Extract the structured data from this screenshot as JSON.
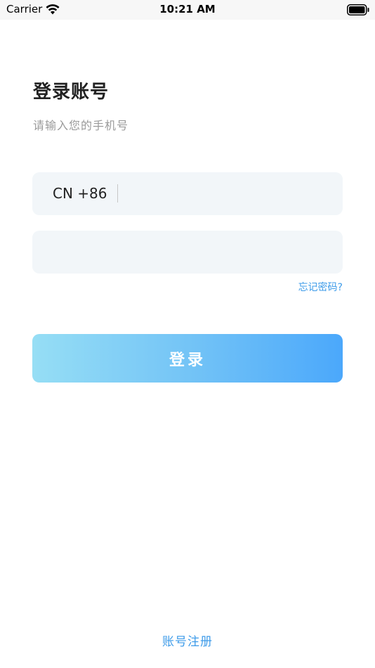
{
  "status_bar": {
    "carrier": "Carrier",
    "time": "10:21 AM"
  },
  "header": {
    "title": "登录账号",
    "subtitle": "请输入您的手机号"
  },
  "phone_field": {
    "country_code": "CN +86",
    "value": "",
    "placeholder": ""
  },
  "password_field": {
    "value": "",
    "placeholder": ""
  },
  "links": {
    "forgot_password": "忘记密码?",
    "register": "账号注册"
  },
  "buttons": {
    "login": "登录"
  },
  "colors": {
    "accent": "#3d9be9",
    "field_bg": "#f2f6f9",
    "button_gradient_start": "#96def5",
    "button_gradient_end": "#4ba8fb"
  },
  "icons": {
    "wifi": "wifi-icon",
    "battery": "battery-icon"
  }
}
